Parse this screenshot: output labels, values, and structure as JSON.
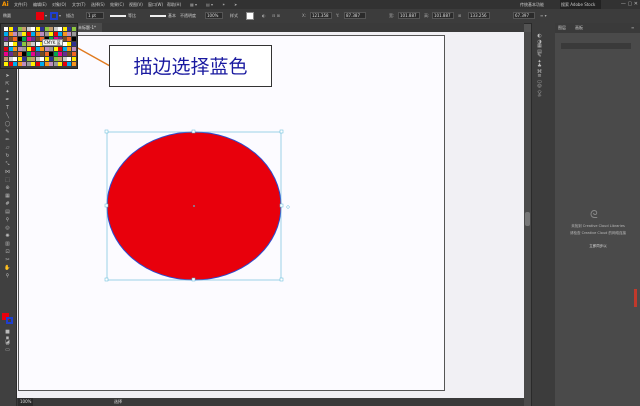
{
  "menubar": {
    "logo": "Ai",
    "items": [
      "文件(F)",
      "编辑(E)",
      "对象(O)",
      "文字(T)",
      "选择(S)",
      "效果(C)",
      "视图(V)",
      "窗口(W)",
      "帮助(H)"
    ],
    "workspace": "传统基本功能",
    "search": "搜索 Adobe Stock",
    "window_controls": "— ▢ ✕"
  },
  "options": {
    "mode": "椭圆",
    "stroke_label": "描边",
    "stroke_weight": "1 pt",
    "profile_uniform": "等比",
    "brush_basic": "基本",
    "opacity_label": "不透明度",
    "opacity": "100%",
    "style_label": "样式",
    "x_value": "121.358",
    "y_value": "87.387",
    "w_value": "101.887",
    "h_value": "101.887",
    "extra_w": "133.256",
    "extra_h": "67.397",
    "colors": {
      "fill": "#e8000c",
      "stroke": "#1f3fcf"
    }
  },
  "document": {
    "tab_label": "未标题-1*"
  },
  "palette": {
    "tooltip": "CMYK 蓝"
  },
  "callout": {
    "text": "描边选择蓝色"
  },
  "statusbar": {
    "zoom": "100%",
    "tool_name": "选择"
  },
  "panel": {
    "tabs": [
      "图层",
      "画板"
    ],
    "message1": "未找到 Creative Cloud Libraries",
    "message2": "请检查 Creative Cloud 的网络连接",
    "link": "立即同步以"
  },
  "ellipse": {
    "fill": "#e8000c",
    "stroke": "#2a4bd1"
  }
}
